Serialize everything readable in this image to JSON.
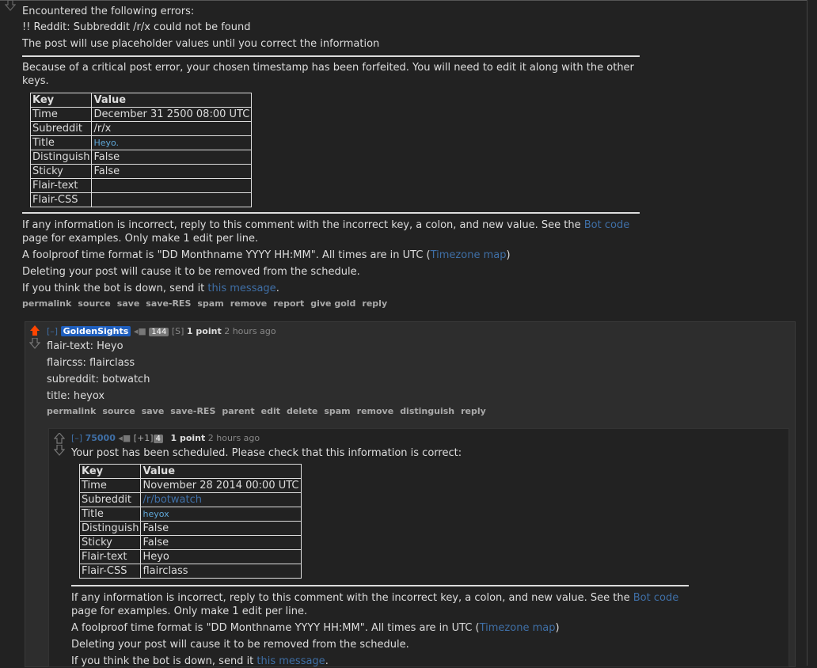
{
  "top_comment": {
    "error_header": "Encountered the following errors:",
    "error_line": "!! Reddit: Subbreddit /r/x could not be found",
    "placeholder_note": "The post will use placeholder values until you correct the information",
    "forfeit_note": "Because of a critical post error, your chosen timestamp has been forfeited. You will need to edit it along with the other keys.",
    "table": {
      "headers": [
        "Key",
        "Value"
      ],
      "rows": [
        [
          "Time",
          "December 31 2500 08:00 UTC"
        ],
        [
          "Subreddit",
          "/r/x"
        ],
        [
          "Title",
          "Heyo."
        ],
        [
          "Distinguish",
          "False"
        ],
        [
          "Sticky",
          "False"
        ],
        [
          "Flair-text",
          ""
        ],
        [
          "Flair-CSS",
          ""
        ]
      ]
    },
    "info_pre": "If any information is incorrect, reply to this comment with the incorrect key, a colon, and new value. See the ",
    "info_link": "Bot code",
    "info_post": " page for examples. Only make 1 edit per line.",
    "format_pre": "A foolproof time format is \"DD Monthname YYYY HH:MM\". All times are in UTC (",
    "format_link": "Timezone map",
    "format_post": ")",
    "delete_note": "Deleting your post will cause it to be removed from the schedule.",
    "down_pre": "If you think the bot is down, send it ",
    "down_link": "this message",
    "down_post": ".",
    "buttons": [
      "permalink",
      "source",
      "save",
      "save-RES",
      "spam",
      "remove",
      "report",
      "give gold",
      "reply"
    ]
  },
  "reply1": {
    "expand": "[–]",
    "author": "GoldenSights",
    "badge": "144",
    "flair": "[S]",
    "score": "1 point",
    "time": "2 hours ago",
    "lines": [
      "flair-text: Heyo",
      "flaircss: flairclass",
      "subreddit: botwatch",
      "title: heyox"
    ],
    "buttons": [
      "permalink",
      "source",
      "save",
      "save-RES",
      "parent",
      "edit",
      "delete",
      "spam",
      "remove",
      "distinguish",
      "reply"
    ]
  },
  "reply2": {
    "expand": "[–]",
    "author": "75000",
    "vote_tag": "[+1]",
    "badge": "4",
    "score": "1 point",
    "time": "2 hours ago",
    "scheduled": "Your post has been scheduled. Please check that this information is correct:",
    "table": {
      "headers": [
        "Key",
        "Value"
      ],
      "rows": [
        [
          "Time",
          "November 28 2014 00:00 UTC"
        ],
        [
          "Subreddit",
          "/r/botwatch"
        ],
        [
          "Title",
          "heyox"
        ],
        [
          "Distinguish",
          "False"
        ],
        [
          "Sticky",
          "False"
        ],
        [
          "Flair-text",
          "Heyo"
        ],
        [
          "Flair-CSS",
          "flairclass"
        ]
      ]
    },
    "info_pre": "If any information is incorrect, reply to this comment with the incorrect key, a colon, and new value. See the ",
    "info_link": "Bot code",
    "info_post": " page for examples. Only make 1 edit per line.",
    "format_pre": "A foolproof time format is \"DD Monthname YYYY HH:MM\". All times are in UTC (",
    "format_link": "Timezone map",
    "format_post": ")",
    "delete_note": "Deleting your post will cause it to be removed from the schedule.",
    "down_pre": "If you think the bot is down, send it ",
    "down_link": "this message",
    "down_post": "."
  },
  "colors": {
    "background": "#222222",
    "text": "#dddddd",
    "link": "#3f6fa6",
    "upvote": "#ff4500",
    "author_highlight": "#1f5fbf"
  }
}
